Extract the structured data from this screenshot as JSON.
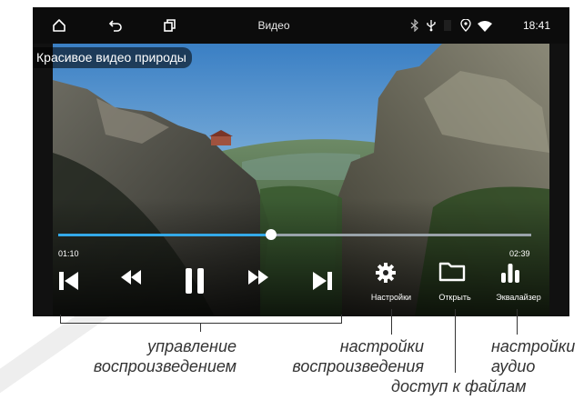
{
  "status_bar": {
    "title": "Видео",
    "time": "18:41",
    "icons": [
      "home-icon",
      "back-icon",
      "recents-icon",
      "bluetooth-icon",
      "usb-icon",
      "location-icon",
      "wifi-icon"
    ]
  },
  "video": {
    "title": "Красивое видео природы",
    "current_time": "01:10",
    "total_time": "02:39",
    "progress": 0.45
  },
  "controls": {
    "settings_label": "Настройки",
    "open_label": "Открыть",
    "equalizer_label": "Эквалайзер",
    "icons": [
      "skip-previous-icon",
      "rewind-icon",
      "pause-icon",
      "fast-forward-icon",
      "skip-next-icon",
      "gear-icon",
      "folder-icon",
      "equalizer-icon"
    ]
  },
  "annotations": {
    "playback_control": "управление воспроизведением",
    "playback_settings": "настройки воспроизведения",
    "audio_settings": "настройки аудио",
    "file_access": "доступ к файлам"
  },
  "colors": {
    "accent": "#34a9e8",
    "status_bar": "#0c0c0c",
    "annotation_text": "#333333"
  }
}
